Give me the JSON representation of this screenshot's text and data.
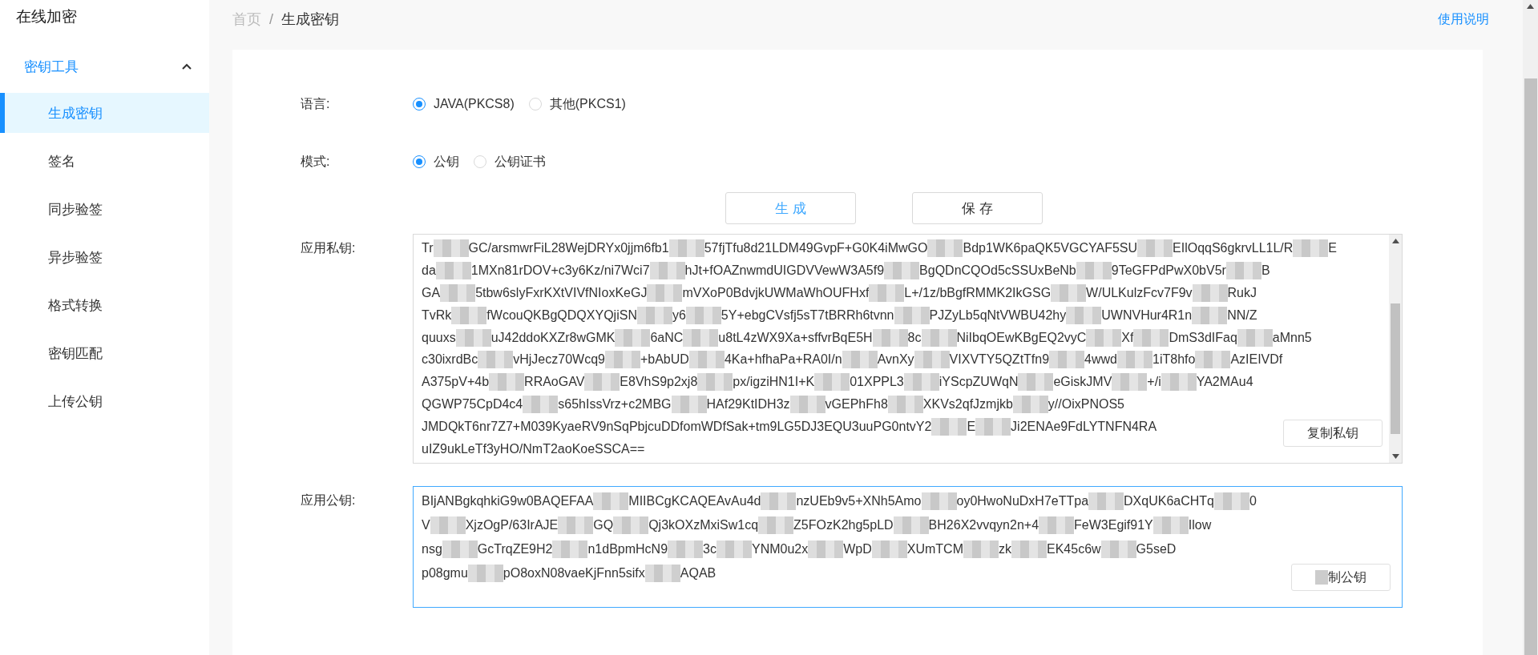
{
  "sidebar": {
    "title": "在线加密",
    "groups": [
      {
        "label": "密钥工具",
        "expanded": true,
        "items": [
          {
            "label": "生成密钥",
            "selected": true
          },
          {
            "label": "签名",
            "selected": false
          },
          {
            "label": "同步验签",
            "selected": false
          },
          {
            "label": "异步验签",
            "selected": false
          },
          {
            "label": "格式转换",
            "selected": false
          },
          {
            "label": "密钥匹配",
            "selected": false
          },
          {
            "label": "上传公钥",
            "selected": false
          }
        ]
      }
    ]
  },
  "breadcrumb": {
    "items": [
      {
        "label": "首页",
        "current": false
      },
      {
        "label": "生成密钥",
        "current": true
      }
    ],
    "separator": "/"
  },
  "help_link": "使用说明",
  "form": {
    "rows": [
      {
        "label": "语言:",
        "options": [
          {
            "label": "JAVA(PKCS8)",
            "selected": true
          },
          {
            "label": "其他(PKCS1)",
            "selected": false
          }
        ]
      },
      {
        "label": "模式:",
        "options": [
          {
            "label": "公钥",
            "selected": true
          },
          {
            "label": "公钥证书",
            "selected": false
          }
        ]
      }
    ],
    "buttons": [
      {
        "label": "生 成",
        "kind": "primary"
      },
      {
        "label": "保 存",
        "kind": "default"
      }
    ],
    "keys": [
      {
        "label": "应用私钥:",
        "focused": false,
        "scrollbar": true,
        "copy_button": {
          "label": "复制私钥",
          "covered_start": false
        },
        "lines": [
          [
            "Tr",
            "GC/arsmwrFiL28WejDRYx0jjm6fb1",
            "57fjTfu8d21LDM49GvpF+G0K4iMwGO",
            "Bdp1WK6paQK5VGCYAF5SU",
            "EIlOqqS6gkrvLL1L/R",
            "E"
          ],
          [
            "da",
            "1MXn81rDOV+c3y6Kz/ni7Wci7",
            "hJt+fOAZnwmdUIGDVVewW3A5f9",
            "BgQDnCQOd5cSSUxBeNb",
            "9TeGFPdPwX0bV5r",
            "B"
          ],
          [
            "GA",
            "5tbw6slyFxrKXtVIVfNIoxKeGJ",
            "mVXoP0BdvjkUWMaWhOUFHxf",
            "L+/1z/bBgfRMMK2IkGSG",
            "W/ULKulzFcv7F9v",
            "RukJ"
          ],
          [
            "TvRk",
            "fWcouQKBgQDQXYQjiSN",
            "y6",
            "5Y+ebgCVsfj5sT7tBRRh6tvnn",
            "PJZyLb5qNtVWBU42hy",
            "UWNVHur4R1n",
            "NN/Z"
          ],
          [
            "quuxs",
            "uJ42ddoKXZr8wGMK",
            "6aNC",
            "u8tL4zWX9Xa+sffvrBqE5H",
            "8c",
            "NiIbqOEwKBgEQ2vyC",
            "Xf",
            "DmS3dIFaq",
            "aMnn5"
          ],
          [
            "c30ixrdBc",
            "vHjJecz70Wcq9",
            "+bAbUD",
            "4Ka+hfhaPa+RA0I/n",
            "AvnXy",
            "VIXVTY5QZtTfn9",
            "4wwd",
            "1iT8hfo",
            "AzIEIVDf"
          ],
          [
            "A375pV+4b",
            "RRAoGAV",
            "E8VhS9p2xj8",
            "px/igziHN1I+K",
            "01XPPL3",
            "iYScpZUWqN",
            "eGiskJMV",
            "+/i",
            "YA2MAu4"
          ],
          [
            "QGWP75CpD4c4",
            "s65hIssVrz+c2MBG",
            "HAf29KtIDH3z",
            "vGEPhFh8",
            "XKVs2qfJzmjkb",
            "y//OixPNOS5"
          ],
          [
            "JMDQkT6nr7Z7+M039KyaeRV9nSqPbjcuDDfomWDfSak+tm9LG5DJ3EQU3uuPG0ntvY2",
            "E",
            "Ji2ENAe9FdLYTNFN4RA"
          ],
          [
            "uIZ9ukLeTf3yHO/NmT2aoKoeSSCA=="
          ]
        ]
      },
      {
        "label": "应用公钥:",
        "focused": true,
        "scrollbar": false,
        "copy_button": {
          "label": "制公钥",
          "covered_start": true
        },
        "lines": [
          [
            "BIjANBgkqhkiG9w0BAQEFAA",
            "MIIBCgKCAQEAvAu4d",
            "nzUEb9v5+XNh5Amo",
            "oy0HwoNuDxH7eTTpa",
            "DXqUK6aCHTq",
            "0"
          ],
          [
            "V",
            "XjzOgP/63IrAJE",
            "GQ",
            "Qj3kOXzMxiSw1cq",
            "Z5FOzK2hg5pLD",
            "BH26X2vvqyn2n+4",
            "FeW3Egif91Y",
            "Ilow"
          ],
          [
            "nsg",
            "GcTrqZE9H2",
            "n1dBpmHcN9",
            "3c",
            "YNM0u2x",
            "WpD",
            "XUmTCM",
            "zk",
            "EK45c6w",
            "G5seD"
          ],
          [
            "p08gmu",
            "pO8oxN08vaeKjFnn5sifx",
            "AQAB"
          ]
        ]
      }
    ]
  }
}
